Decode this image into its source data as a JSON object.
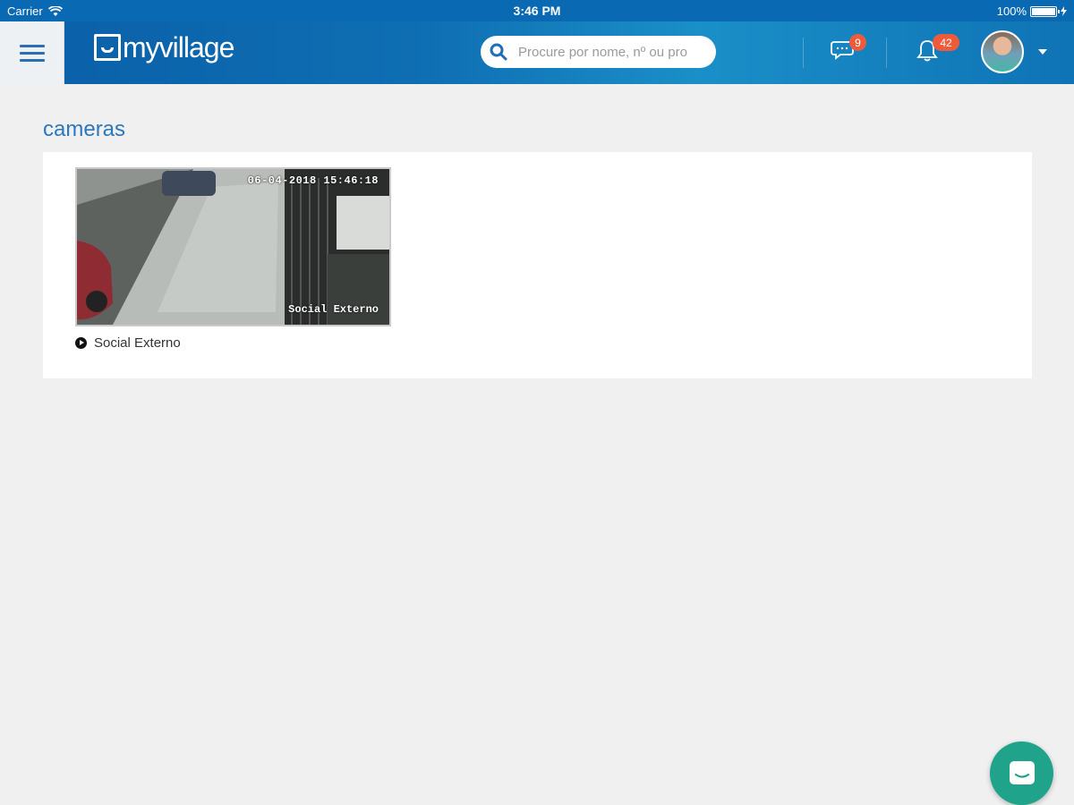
{
  "status_bar": {
    "carrier": "Carrier",
    "time": "3:46 PM",
    "battery": "100%"
  },
  "header": {
    "logo_text": "myvillage",
    "search": {
      "placeholder": "Procure por nome, nº ou pro",
      "value": ""
    },
    "messages_badge": "9",
    "notifications_badge": "42"
  },
  "page": {
    "title": "cameras"
  },
  "cameras": [
    {
      "name": "Social Externo",
      "overlay_timestamp": "06-04-2018 15:46:18",
      "overlay_label": "Social Externo"
    }
  ],
  "colors": {
    "header_blue": "#0a69b3",
    "title_blue": "#2b78bd",
    "badge_red": "#ee5b3b",
    "fab_green": "#1fa38a"
  },
  "icons": {
    "menu": "hamburger-icon",
    "search": "search-icon",
    "messages": "chat-bubble-icon",
    "notifications": "bell-icon",
    "play": "play-circle-icon",
    "fab": "chat-icon"
  }
}
